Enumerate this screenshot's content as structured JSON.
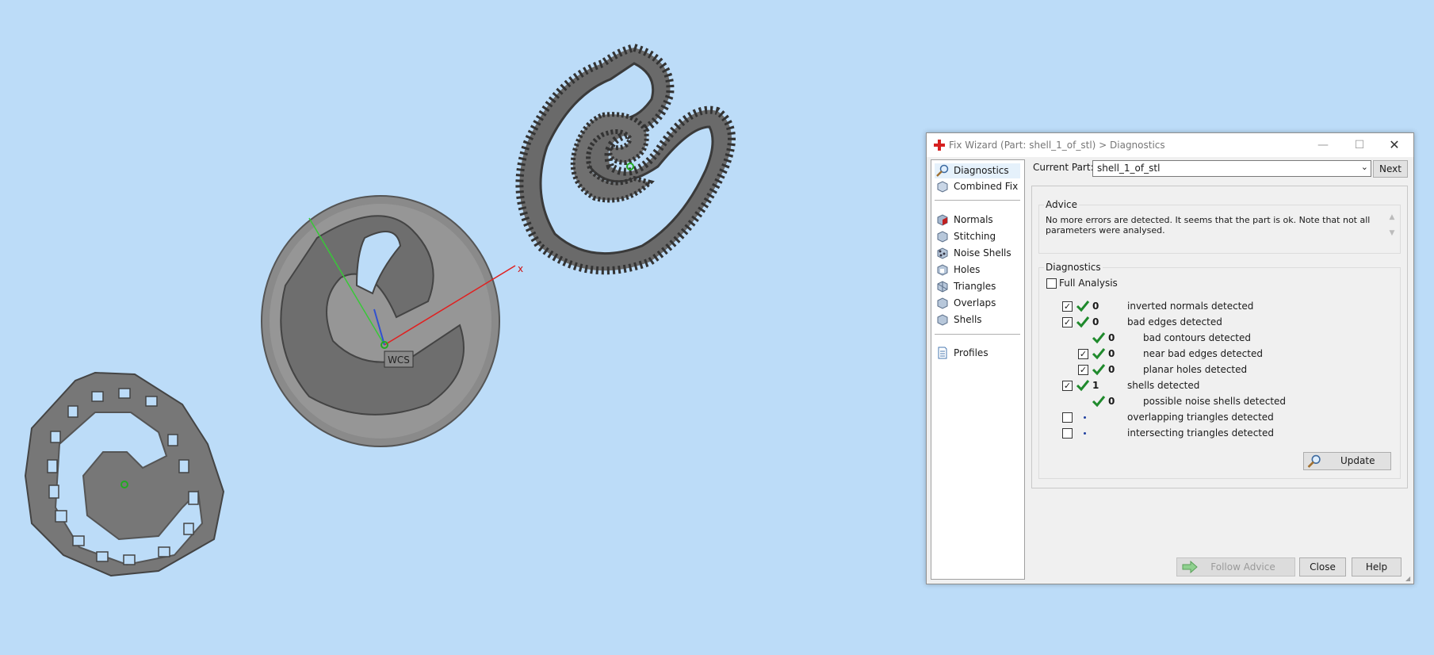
{
  "viewport": {
    "wcs_label": "WCS",
    "axis_x_label": "x"
  },
  "dialog": {
    "title": "Fix Wizard (Part: shell_1_of_stl) > Diagnostics",
    "nav": [
      {
        "label": "Diagnostics",
        "icon": "magnifier-icon"
      },
      {
        "label": "Combined Fix",
        "icon": "cube-icon"
      },
      {
        "label": "Normals",
        "icon": "normals-cube-icon"
      },
      {
        "label": "Stitching",
        "icon": "stitching-cube-icon"
      },
      {
        "label": "Noise Shells",
        "icon": "noise-shells-icon"
      },
      {
        "label": "Holes",
        "icon": "holes-cube-icon"
      },
      {
        "label": "Triangles",
        "icon": "triangles-cube-icon"
      },
      {
        "label": "Overlaps",
        "icon": "overlaps-cube-icon"
      },
      {
        "label": "Shells",
        "icon": "shells-cube-icon"
      },
      {
        "label": "Profiles",
        "icon": "document-icon"
      }
    ],
    "current_part_label": "Current Part:",
    "current_part_value": "shell_1_of_stl",
    "next_label": "Next",
    "advice_title": "Advice",
    "advice_text": "No more errors are detected. It seems that the part is ok. Note that not all parameters were analysed.",
    "diagnostics_title": "Diagnostics",
    "full_analysis_label": "Full Analysis",
    "rows": [
      {
        "checked": true,
        "status": "ok",
        "count": "0",
        "label": "inverted normals detected",
        "indent": 0
      },
      {
        "checked": true,
        "status": "ok",
        "count": "0",
        "label": "bad edges detected",
        "indent": 0
      },
      {
        "checked": null,
        "status": "ok",
        "count": "0",
        "label": "bad contours detected",
        "indent": 1
      },
      {
        "checked": true,
        "status": "ok",
        "count": "0",
        "label": "near bad edges detected",
        "indent": 1
      },
      {
        "checked": true,
        "status": "ok",
        "count": "0",
        "label": "planar holes detected",
        "indent": 1
      },
      {
        "checked": true,
        "status": "ok",
        "count": "1",
        "label": "shells detected",
        "indent": 0
      },
      {
        "checked": null,
        "status": "ok",
        "count": "0",
        "label": "possible noise shells detected",
        "indent": 1
      },
      {
        "checked": false,
        "status": "pending",
        "count": "",
        "label": "overlapping triangles detected",
        "indent": 0
      },
      {
        "checked": false,
        "status": "pending",
        "count": "",
        "label": "intersecting triangles detected",
        "indent": 0
      }
    ],
    "update_label": "Update",
    "follow_advice_label": "Follow Advice",
    "close_label": "Close",
    "help_label": "Help"
  }
}
